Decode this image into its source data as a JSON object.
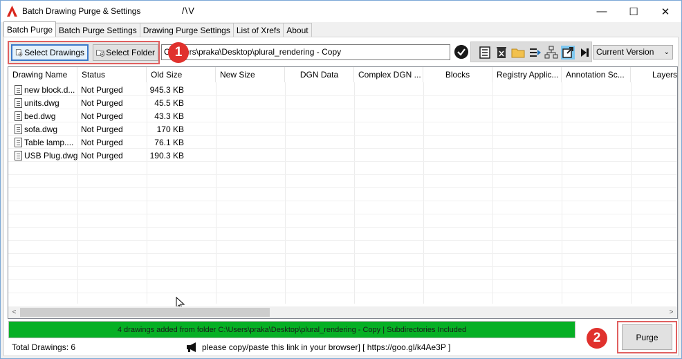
{
  "window": {
    "title": "Batch Drawing Purge & Settings",
    "title_extra": "/\\V",
    "controls": {
      "minimize": "—",
      "maximize": "☐",
      "close": "✕"
    }
  },
  "tabs": [
    {
      "label": "Batch Purge",
      "active": true
    },
    {
      "label": "Batch Purge Settings",
      "active": false
    },
    {
      "label": "Drawing Purge Settings",
      "active": false
    },
    {
      "label": "List of Xrefs",
      "active": false
    },
    {
      "label": "About",
      "active": false
    }
  ],
  "toolbar": {
    "select_drawings_label": "Select Drawings",
    "select_folder_label": "Select Folder",
    "path_value": "C:\\Users\\praka\\Desktop\\plural_rendering - Copy",
    "callout_1": "1",
    "icons": [
      "list-icon",
      "delete-icon",
      "folder-icon",
      "export-icon",
      "hierarchy-icon",
      "open-external-icon",
      "skip-icon"
    ],
    "version_selected": "Current Version",
    "version_arrow": "⌄"
  },
  "grid": {
    "columns": [
      "Drawing Name",
      "Status",
      "Old Size",
      "New Size",
      "DGN Data",
      "Complex DGN ...",
      "Blocks",
      "Registry Applic...",
      "Annotation Sc...",
      "Layers"
    ],
    "rows": [
      {
        "name": "new block.d...",
        "status": "Not Purged",
        "old_size": "945.3 KB"
      },
      {
        "name": "units.dwg",
        "status": "Not Purged",
        "old_size": "45.5 KB"
      },
      {
        "name": "bed.dwg",
        "status": "Not Purged",
        "old_size": "43.3 KB"
      },
      {
        "name": "sofa.dwg",
        "status": "Not Purged",
        "old_size": "170 KB"
      },
      {
        "name": "Table lamp....",
        "status": "Not Purged",
        "old_size": "76.1 KB"
      },
      {
        "name": "USB Plug.dwg",
        "status": "Not Purged",
        "old_size": "190.3 KB"
      }
    ],
    "scroll_left": "<",
    "scroll_right": ">"
  },
  "status": {
    "message": "4 drawings added from folder C:\\Users\\praka\\Desktop\\plural_rendering - Copy | Subdirectories Included",
    "color": "#06b025"
  },
  "purge": {
    "label": "Purge",
    "callout_2": "2"
  },
  "footer": {
    "total": "Total Drawings: 6",
    "link_text": "please copy/paste this link in your browser] [ https://goo.gl/k4Ae3P ]"
  },
  "colors": {
    "callout": "#e0312d",
    "highlight_border": "#e06060",
    "focus_blue": "#3a78c9"
  }
}
